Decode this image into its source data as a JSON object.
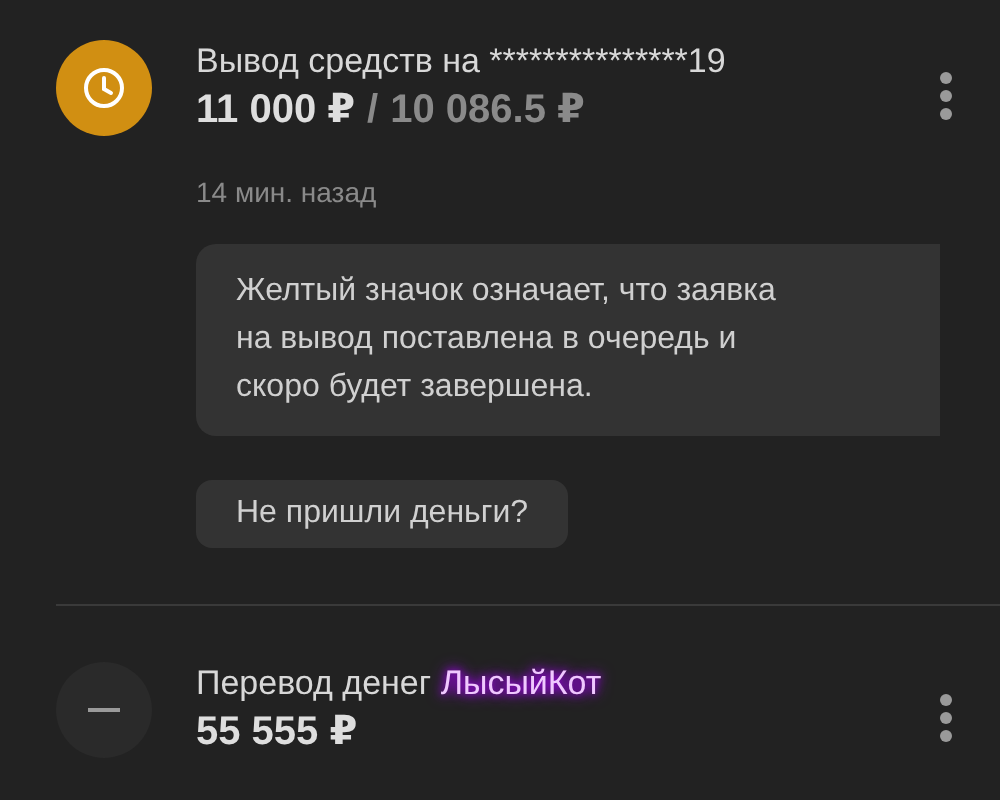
{
  "operations": [
    {
      "kind": "pending",
      "title": "Вывод средств на ***************19",
      "amount": "11 000 ₽",
      "separator": "/",
      "received": "10 086.5 ₽",
      "time": "14 мин. назад",
      "note": "Желтый значок означает, что заявка на вывод поставлена в очередь и скоро будет завершена.",
      "action": "Не пришли деньги?"
    },
    {
      "kind": "neutral",
      "title": "Перевод денег",
      "recipient": "ЛысыйКот",
      "amount": "55 555 ₽"
    }
  ]
}
